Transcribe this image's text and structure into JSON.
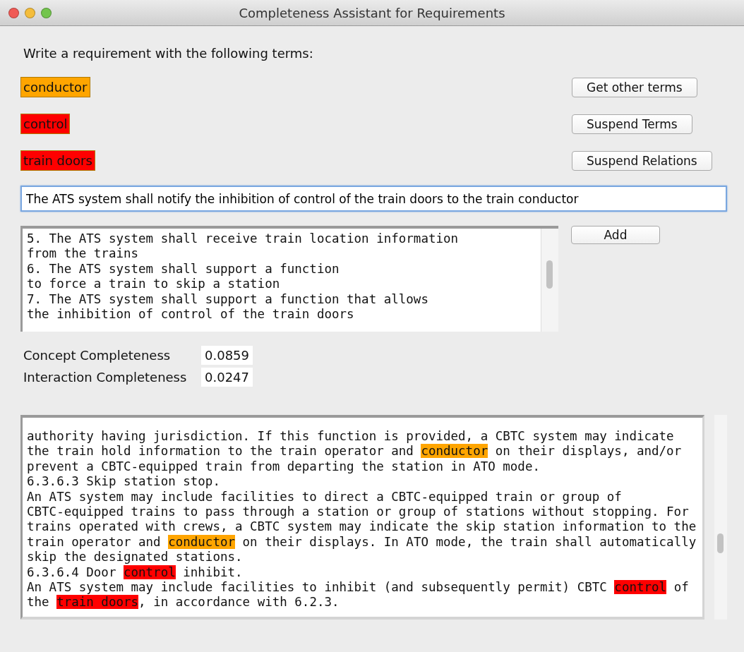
{
  "window": {
    "title": "Completeness Assistant for Requirements"
  },
  "prompt": "Write a requirement with the following terms:",
  "terms": [
    {
      "text": "conductor",
      "color": "#ffa500"
    },
    {
      "text": "control",
      "color": "#ff0000"
    },
    {
      "text": "train doors",
      "color": "#ff0000"
    }
  ],
  "term_buttons": [
    "Get other terms",
    "Suspend Terms",
    "Suspend Relations"
  ],
  "requirement_input": {
    "value": "The ATS system shall notify the inhibition of control of the train doors to the train conductor"
  },
  "requirements_list": [
    "5. The ATS system shall receive train location information",
    "from the trains",
    "6. The ATS system shall support a function",
    "to force a train to skip a station",
    "7. The ATS system shall support a function that allows",
    "the inhibition of control of the train doors"
  ],
  "add_button": "Add",
  "metrics": [
    {
      "label": "Concept Completeness",
      "value": "0.0859"
    },
    {
      "label": "Interaction Completeness",
      "value": "0.0247"
    }
  ],
  "document": [
    [
      {
        "text": "authority having jurisdiction. If this function is provided, a CBTC system may indicate"
      }
    ],
    [
      {
        "text": "the train hold information to the train operator and "
      },
      {
        "text": "conductor",
        "color": "#ffa500"
      },
      {
        "text": " on their displays, and/or"
      }
    ],
    [
      {
        "text": "prevent a CBTC-equipped train from departing the station in ATO mode."
      }
    ],
    [
      {
        "text": "6.3.6.3 Skip station stop."
      }
    ],
    [
      {
        "text": "An ATS system may include facilities to direct a CBTC-equipped train or group of"
      }
    ],
    [
      {
        "text": "CBTC-equipped trains to pass through a station or group of stations without stopping. For"
      }
    ],
    [
      {
        "text": "trains operated with crews, a CBTC system may indicate the skip station information to the"
      }
    ],
    [
      {
        "text": "train operator and "
      },
      {
        "text": "conductor",
        "color": "#ffa500"
      },
      {
        "text": " on their displays. In ATO mode, the train shall automatically"
      }
    ],
    [
      {
        "text": "skip the designated stations."
      }
    ],
    [
      {
        "text": "6.3.6.4 Door "
      },
      {
        "text": "control",
        "color": "#ff0000"
      },
      {
        "text": " inhibit."
      }
    ],
    [
      {
        "text": "An ATS system may include facilities to inhibit (and subsequently permit) CBTC "
      },
      {
        "text": "control",
        "color": "#ff0000"
      },
      {
        "text": " of"
      }
    ],
    [
      {
        "text": "the "
      },
      {
        "text": "train doors",
        "color": "#ff0000"
      },
      {
        "text": ", in accordance with 6.2.3."
      }
    ]
  ]
}
